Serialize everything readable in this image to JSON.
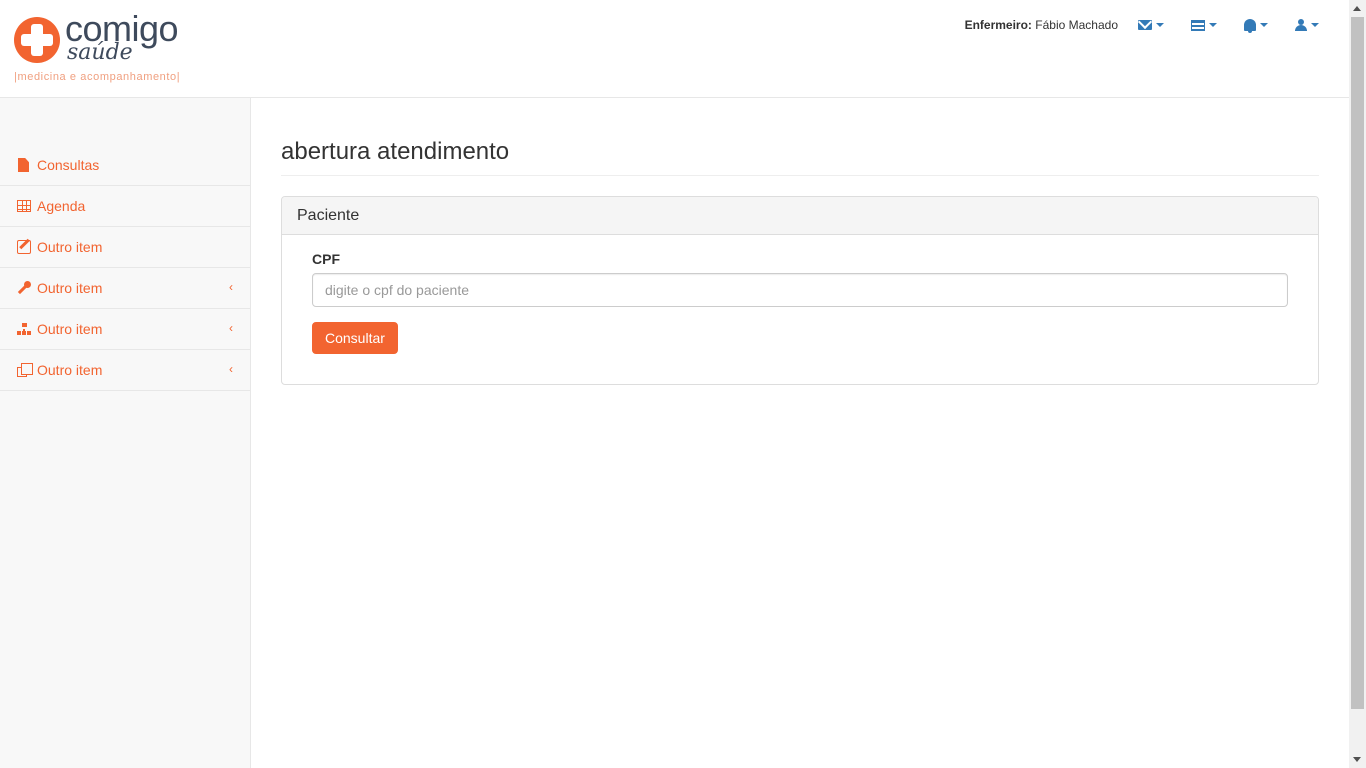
{
  "brand": {
    "name_top": "comigo",
    "name_bottom": "saúde",
    "tagline": "|medicina e acompanhamento|",
    "accent_color": "#f26430"
  },
  "header": {
    "user_role_label": "Enfermeiro:",
    "user_name": "Fábio Machado",
    "dropdowns": [
      {
        "icon": "envelope-icon"
      },
      {
        "icon": "tasks-icon"
      },
      {
        "icon": "bell-icon"
      },
      {
        "icon": "user-icon"
      }
    ],
    "icon_color": "#337ab7"
  },
  "sidebar": {
    "items": [
      {
        "label": "Consultas",
        "icon": "file-icon",
        "has_submenu": false
      },
      {
        "label": "Agenda",
        "icon": "table-icon",
        "has_submenu": false
      },
      {
        "label": "Outro item",
        "icon": "edit-icon",
        "has_submenu": false
      },
      {
        "label": "Outro item",
        "icon": "wrench-icon",
        "has_submenu": true
      },
      {
        "label": "Outro item",
        "icon": "sitemap-icon",
        "has_submenu": true
      },
      {
        "label": "Outro item",
        "icon": "clone-icon",
        "has_submenu": true
      }
    ],
    "submenu_arrow": "‹"
  },
  "main": {
    "page_title": "abertura atendimento",
    "panel": {
      "heading": "Paciente",
      "cpf_label": "CPF",
      "cpf_value": "",
      "cpf_placeholder": "digite o cpf do paciente",
      "submit_label": "Consultar"
    }
  }
}
